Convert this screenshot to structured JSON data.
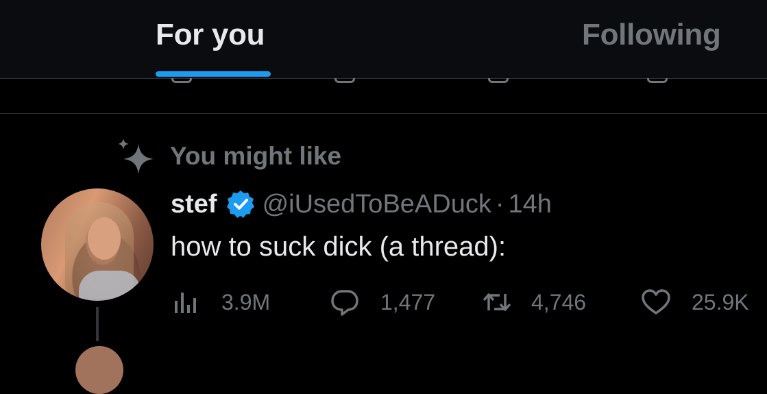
{
  "tabs": {
    "for_you": "For you",
    "following": "Following"
  },
  "suggestion": {
    "label": "You might like",
    "icon": "sparkle-icon"
  },
  "tweet": {
    "name": "stef",
    "handle": "@iUsedToBeADuck",
    "separator": "·",
    "time": "14h",
    "text": "how to suck dick (a thread):",
    "verified": true
  },
  "actions": {
    "views": "3.9M",
    "replies": "1,477",
    "retweets": "4,746",
    "likes": "25.9K"
  },
  "colors": {
    "accent": "#1d9bf0",
    "muted": "#71767b",
    "text": "#e7e9ea",
    "background": "#000000"
  }
}
